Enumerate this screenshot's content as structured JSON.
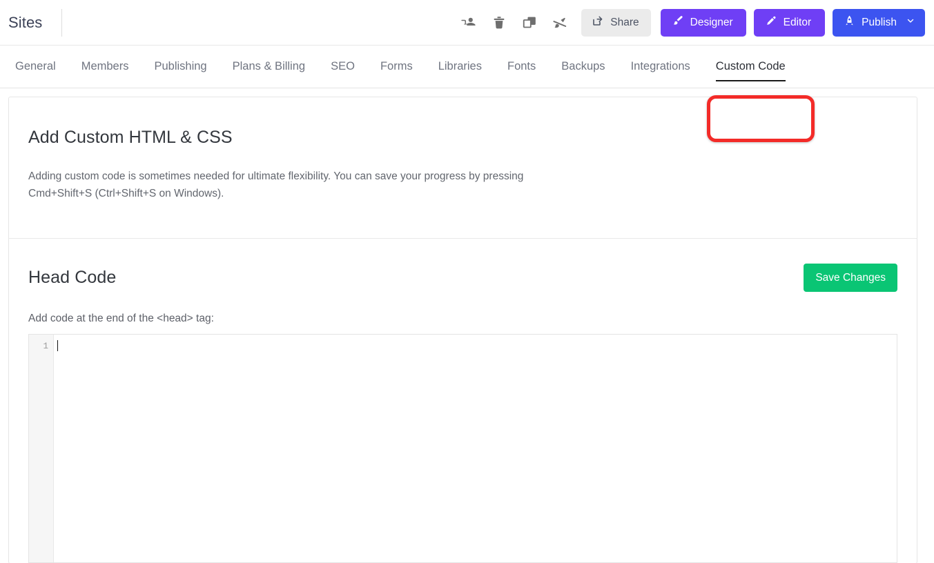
{
  "header": {
    "brand": "Sites",
    "icons": [
      {
        "name": "transfer-site-icon",
        "title": "Transfer site"
      },
      {
        "name": "delete-site-icon",
        "title": "Delete site"
      },
      {
        "name": "duplicate-site-icon",
        "title": "Duplicate site"
      },
      {
        "name": "unpublish-site-icon",
        "title": "Unpublish site"
      }
    ],
    "share_label": "Share",
    "designer_label": "Designer",
    "editor_label": "Editor",
    "publish_label": "Publish"
  },
  "tabs": [
    {
      "label": "General",
      "active": false
    },
    {
      "label": "Members",
      "active": false
    },
    {
      "label": "Publishing",
      "active": false
    },
    {
      "label": "Plans & Billing",
      "active": false
    },
    {
      "label": "SEO",
      "active": false
    },
    {
      "label": "Forms",
      "active": false
    },
    {
      "label": "Libraries",
      "active": false
    },
    {
      "label": "Fonts",
      "active": false
    },
    {
      "label": "Backups",
      "active": false
    },
    {
      "label": "Integrations",
      "active": false
    },
    {
      "label": "Custom Code",
      "active": true
    }
  ],
  "main": {
    "title": "Add Custom HTML & CSS",
    "description": "Adding custom code is sometimes needed for ultimate flexibility. You can save your progress by pressing Cmd+Shift+S (Ctrl+Shift+S on Windows).",
    "head_section": {
      "title": "Head Code",
      "save_label": "Save Changes",
      "field_label": "Add code at the end of the <head> tag:",
      "line_number": "1",
      "code_value": ""
    }
  },
  "colors": {
    "designer_purple": "#6f3ff5",
    "editor_purple": "#6f3ff5",
    "publish_blue": "#3c54f0",
    "save_green": "#0ac574",
    "annotation_red": "#f32b28",
    "share_gray": "#ebebeb"
  }
}
